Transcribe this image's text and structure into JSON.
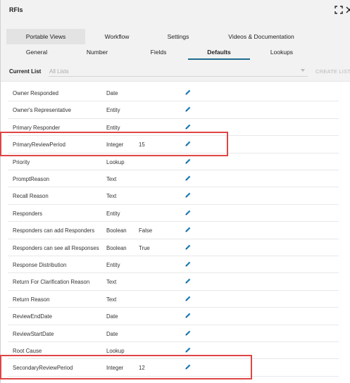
{
  "window": {
    "title": "RFIs"
  },
  "header_icons": [
    {
      "name": "expand-icon"
    },
    {
      "name": "close-icon"
    }
  ],
  "tabs_primary": [
    {
      "label": "Portable Views",
      "active": true
    },
    {
      "label": "Workflow",
      "active": false
    },
    {
      "label": "Settings",
      "active": false
    },
    {
      "label": "Videos & Documentation",
      "active": false
    }
  ],
  "tabs_secondary": [
    {
      "label": "General",
      "active": false
    },
    {
      "label": "Number",
      "active": false
    },
    {
      "label": "Fields",
      "active": false
    },
    {
      "label": "Defaults",
      "active": true
    },
    {
      "label": "Lookups",
      "active": false
    }
  ],
  "current_list": {
    "label": "Current List",
    "placeholder": "All Lists",
    "create_button": "CREATE LIST"
  },
  "fields": [
    {
      "name": "Owner Responded",
      "type": "Date",
      "value": ""
    },
    {
      "name": "Owner's Representative",
      "type": "Entity",
      "value": ""
    },
    {
      "name": "Primary Responder",
      "type": "Entity",
      "value": ""
    },
    {
      "name": "PrimaryReviewPeriod",
      "type": "Integer",
      "value": "15",
      "highlighted": true
    },
    {
      "name": "Priority",
      "type": "Lookup",
      "value": ""
    },
    {
      "name": "PromptReason",
      "type": "Text",
      "value": ""
    },
    {
      "name": "Recall Reason",
      "type": "Text",
      "value": ""
    },
    {
      "name": "Responders",
      "type": "Entity",
      "value": ""
    },
    {
      "name": "Responders can add Responders",
      "type": "Boolean",
      "value": "False"
    },
    {
      "name": "Responders can see all Responses",
      "type": "Boolean",
      "value": "True"
    },
    {
      "name": "Response Distribution",
      "type": "Entity",
      "value": ""
    },
    {
      "name": "Return For Clarification Reason",
      "type": "Text",
      "value": ""
    },
    {
      "name": "Return Reason",
      "type": "Text",
      "value": ""
    },
    {
      "name": "ReviewEndDate",
      "type": "Date",
      "value": ""
    },
    {
      "name": "ReviewStartDate",
      "type": "Date",
      "value": ""
    },
    {
      "name": "Root Cause",
      "type": "Lookup",
      "value": ""
    },
    {
      "name": "SecondaryReviewPeriod",
      "type": "Integer",
      "value": "12",
      "highlighted": true
    }
  ],
  "colors": {
    "accent": "#1d6b8f",
    "edit_icon": "#1f7fb8",
    "highlight_border": "#e04545"
  }
}
